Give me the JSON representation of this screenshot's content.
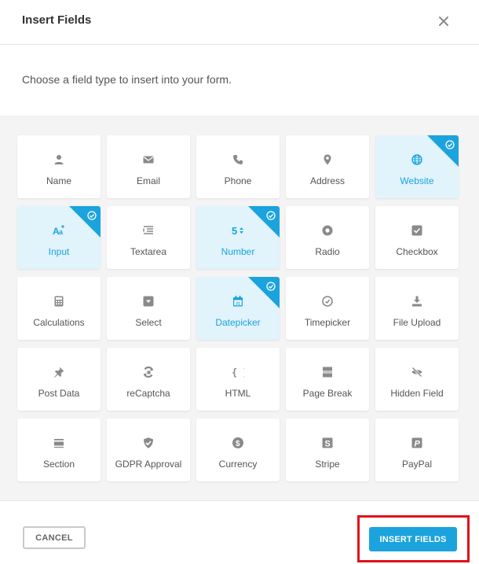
{
  "dialog": {
    "title": "Insert Fields",
    "description": "Choose a field type to insert into your form."
  },
  "fields": [
    {
      "label": "Name",
      "icon": "user-icon",
      "selected": false
    },
    {
      "label": "Email",
      "icon": "envelope-icon",
      "selected": false
    },
    {
      "label": "Phone",
      "icon": "phone-icon",
      "selected": false
    },
    {
      "label": "Address",
      "icon": "map-pin-icon",
      "selected": false
    },
    {
      "label": "Website",
      "icon": "globe-icon",
      "selected": true
    },
    {
      "label": "Input",
      "icon": "text-input-icon",
      "selected": true
    },
    {
      "label": "Textarea",
      "icon": "textarea-icon",
      "selected": false
    },
    {
      "label": "Number",
      "icon": "number-icon",
      "selected": true
    },
    {
      "label": "Radio",
      "icon": "radio-icon",
      "selected": false
    },
    {
      "label": "Checkbox",
      "icon": "checkbox-icon",
      "selected": false
    },
    {
      "label": "Calculations",
      "icon": "calculator-icon",
      "selected": false
    },
    {
      "label": "Select",
      "icon": "select-icon",
      "selected": false
    },
    {
      "label": "Datepicker",
      "icon": "calendar-icon",
      "selected": true
    },
    {
      "label": "Timepicker",
      "icon": "clock-icon",
      "selected": false
    },
    {
      "label": "File Upload",
      "icon": "upload-icon",
      "selected": false
    },
    {
      "label": "Post Data",
      "icon": "pin-icon",
      "selected": false
    },
    {
      "label": "reCaptcha",
      "icon": "recaptcha-icon",
      "selected": false
    },
    {
      "label": "HTML",
      "icon": "code-braces-icon",
      "selected": false
    },
    {
      "label": "Page Break",
      "icon": "page-break-icon",
      "selected": false
    },
    {
      "label": "Hidden Field",
      "icon": "eye-off-icon",
      "selected": false
    },
    {
      "label": "Section",
      "icon": "section-icon",
      "selected": false
    },
    {
      "label": "GDPR Approval",
      "icon": "shield-check-icon",
      "selected": false
    },
    {
      "label": "Currency",
      "icon": "dollar-icon",
      "selected": false
    },
    {
      "label": "Stripe",
      "icon": "stripe-icon",
      "selected": false
    },
    {
      "label": "PayPal",
      "icon": "paypal-icon",
      "selected": false
    }
  ],
  "footer": {
    "cancel_label": "CANCEL",
    "insert_label": "INSERT FIELDS"
  },
  "colors": {
    "accent": "#1ba3dd",
    "selected_bg": "#e1f3fb",
    "icon_gray": "#8a8a8a",
    "highlight_red": "#e0101a"
  }
}
